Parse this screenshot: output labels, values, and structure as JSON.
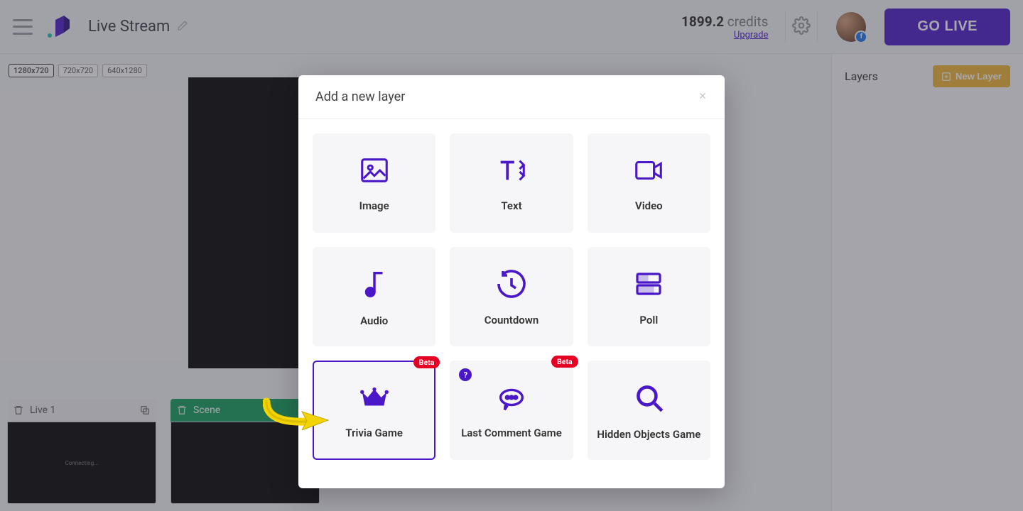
{
  "header": {
    "title": "Live Stream",
    "credits_value": "1899.2",
    "credits_label": "credits",
    "upgrade": "Upgrade",
    "go_live": "GO LIVE"
  },
  "size_chips": {
    "active": "1280x720",
    "b": "720x720",
    "c": "640x1280"
  },
  "scenes": {
    "live_name": "Live 1",
    "live_status": "Connecting...",
    "scene_name": "Scene"
  },
  "right_panel": {
    "title": "Layers",
    "new_layer": "New Layer"
  },
  "modal": {
    "title": "Add a new layer",
    "badge_beta": "Beta",
    "help": "?",
    "tiles": {
      "image": "Image",
      "text": "Text",
      "video": "Video",
      "audio": "Audio",
      "countdown": "Countdown",
      "poll": "Poll",
      "trivia": "Trivia Game",
      "last_comment": "Last Comment Game",
      "hidden_objects": "Hidden Objects Game"
    }
  }
}
